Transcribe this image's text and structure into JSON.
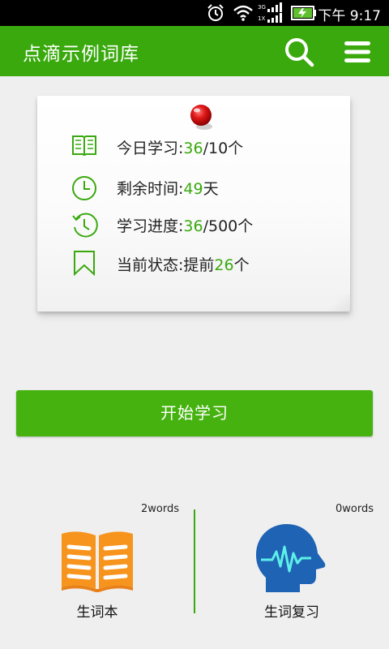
{
  "status_bar": {
    "time": "下午 9:17",
    "network_labels": [
      "3G",
      "1X"
    ]
  },
  "app_bar": {
    "title": "点滴示例词库",
    "search_icon": "search-icon",
    "menu_icon": "menu-icon"
  },
  "stats": {
    "today": {
      "label": "今日学习:",
      "value": "36",
      "suffix": "/10个"
    },
    "remaining": {
      "label": "剩余时间:",
      "value": "49",
      "suffix": "天"
    },
    "progress": {
      "label": "学习进度:",
      "value": "36",
      "suffix": "/500个"
    },
    "state": {
      "label": "当前状态:提前",
      "value": "26",
      "suffix": "个"
    }
  },
  "start_button": {
    "label": "开始学习"
  },
  "vocab_book": {
    "count": "2words",
    "label": "生词本",
    "icon": "book-icon"
  },
  "vocab_review": {
    "count": "0words",
    "label": "生词复习",
    "icon": "head-wave-icon"
  },
  "colors": {
    "accent": "#3aa90e",
    "button": "#45b20f",
    "book_orange": "#f7941d",
    "head_blue": "#1f63b5"
  }
}
